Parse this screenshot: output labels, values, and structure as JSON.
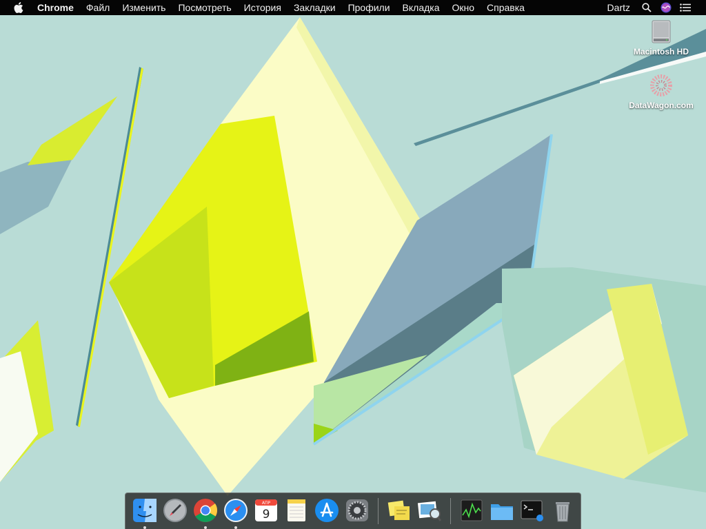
{
  "menubar": {
    "apple_icon": "apple-icon",
    "app_name": "Chrome",
    "menus": [
      "Файл",
      "Изменить",
      "Посмотреть",
      "История",
      "Закладки",
      "Профили",
      "Вкладка",
      "Окно",
      "Справка"
    ],
    "user": "Dartz",
    "status_icons": [
      "spotlight-search-icon",
      "siri-icon",
      "notification-center-icon"
    ]
  },
  "desktop": {
    "icons": [
      {
        "label": "Macintosh HD",
        "icon": "hard-drive-icon"
      },
      {
        "label": "DataWagon.com",
        "icon": "datawagon-icon"
      }
    ]
  },
  "dock": {
    "apps": [
      {
        "name": "Finder",
        "icon": "finder-icon",
        "running": true
      },
      {
        "name": "Launchpad",
        "icon": "launchpad-icon",
        "running": false
      },
      {
        "name": "Google Chrome",
        "icon": "chrome-icon",
        "running": true
      },
      {
        "name": "Safari",
        "icon": "safari-icon",
        "running": true
      },
      {
        "name": "Calendar",
        "icon": "calendar-icon",
        "running": false,
        "month": "АПР",
        "day": "9"
      },
      {
        "name": "Notes",
        "icon": "notes-icon",
        "running": false
      },
      {
        "name": "App Store",
        "icon": "app-store-icon",
        "running": false
      },
      {
        "name": "System Preferences",
        "icon": "system-preferences-icon",
        "running": false
      },
      {
        "name": "Stickies",
        "icon": "stickies-icon",
        "running": false
      },
      {
        "name": "Preview",
        "icon": "preview-icon",
        "running": false
      }
    ],
    "others": [
      {
        "name": "Activity Monitor",
        "icon": "activity-monitor-icon"
      },
      {
        "name": "Folder",
        "icon": "folder-icon"
      },
      {
        "name": "Terminal",
        "icon": "terminal-icon"
      },
      {
        "name": "Trash",
        "icon": "trash-icon"
      }
    ]
  },
  "colors": {
    "menubar": "#050505",
    "wallpaper": "#b9dcd6",
    "accent_yellow": "#e8f520"
  }
}
